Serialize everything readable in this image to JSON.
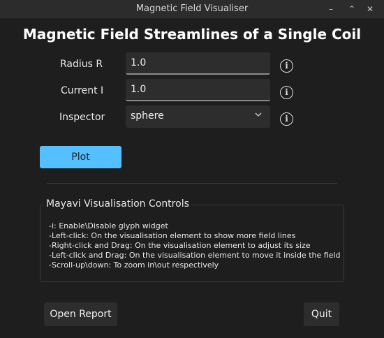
{
  "window": {
    "title": "Magnetic Field Visualiser",
    "controls": {
      "minimize": "–",
      "maximize": "⌃",
      "close": "✕"
    }
  },
  "heading": "Magnetic Field Streamlines of a Single Coil",
  "form": {
    "radius": {
      "label": "Radius R",
      "value": "1.0",
      "info_icon": "info-icon"
    },
    "current": {
      "label": "Current I",
      "value": "1.0",
      "info_icon": "info-icon"
    },
    "inspector": {
      "label": "Inspector",
      "selected": "sphere",
      "info_icon": "info-icon"
    }
  },
  "plot_button": "Plot",
  "controls_group": {
    "title": "Mayavi Visualisation Controls",
    "lines": [
      "-i: Enable\\Disable glyph widget",
      "-Left-click: On the visualisation element to show more field lines",
      "-Right-click and Drag: On the visualisation element to adjust its size",
      "-Left-click and Drag: On the visualisation element to move it inside the field",
      "-Scroll-up\\down: To zoom in\\out respectively"
    ]
  },
  "footer": {
    "open_report": "Open Report",
    "quit": "Quit"
  },
  "colors": {
    "accent": "#55c0ff",
    "background": "#1e1e1e",
    "field": "#2d2d2d"
  }
}
